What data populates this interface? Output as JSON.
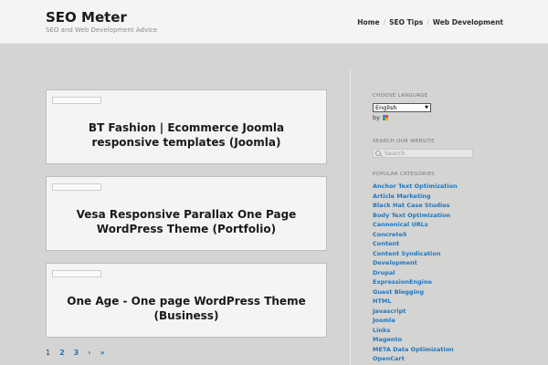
{
  "site": {
    "title": "SEO Meter",
    "description": "SEO and Web Development Advice"
  },
  "nav": {
    "items": [
      {
        "label": "Home"
      },
      {
        "label": "SEO Tips"
      },
      {
        "label": "Web Development"
      }
    ]
  },
  "posts": [
    {
      "title": "BT Fashion | Ecommerce Joomla responsive templates (Joomla)"
    },
    {
      "title": "Vesa Responsive Parallax One Page WordPress Theme (Portfolio)"
    },
    {
      "title": "One Age - One page WordPress Theme (Business)"
    }
  ],
  "pagination": {
    "items": [
      {
        "label": "1",
        "current": true
      },
      {
        "label": "2"
      },
      {
        "label": "3"
      },
      {
        "label": "›"
      },
      {
        "label": "»"
      }
    ]
  },
  "sidebar": {
    "language": {
      "title": "CHOOSE LANGUAGE",
      "selected": "English",
      "by_label": "by"
    },
    "search": {
      "title": "SEARCH OUR WEBSITE",
      "placeholder": "Search"
    },
    "categories": {
      "title": "POPULAR CATEGORIES",
      "items": [
        "Anchor Text Optimization",
        "Article Marketing",
        "Black Hat Case Studies",
        "Body Text Optimization",
        "Cannonical URLs",
        "Concrete5",
        "Content",
        "Content Syndication",
        "Development",
        "Drupal",
        "ExpressionEngine",
        "Guest Blogging",
        "HTML",
        "Javascript",
        "Joomla",
        "Links",
        "Magento",
        "META Data Optimization",
        "OpenCart"
      ]
    }
  },
  "colors": {
    "link": "#1e76c0",
    "background": "#d4d4d2",
    "header": "#f4f4f4"
  }
}
